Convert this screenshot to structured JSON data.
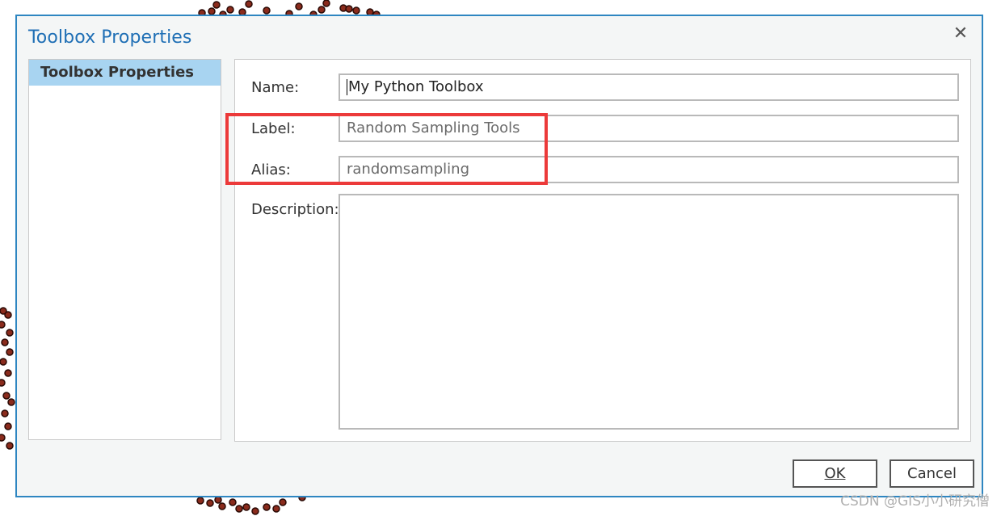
{
  "dialog": {
    "title": "Toolbox Properties",
    "close_icon": "close-icon",
    "nav": {
      "items": [
        {
          "label": "Toolbox Properties",
          "selected": true
        }
      ]
    },
    "form": {
      "name": {
        "label": "Name:",
        "value": "My Python Toolbox"
      },
      "label": {
        "label": "Label:",
        "value": "Random Sampling Tools"
      },
      "alias": {
        "label": "Alias:",
        "value": "randomsampling"
      },
      "description": {
        "label": "Description:",
        "value": ""
      }
    },
    "buttons": {
      "ok": "OK",
      "cancel": "Cancel"
    }
  },
  "watermark": "CSDN @GIS小小研究僧",
  "colors": {
    "title": "#1f6fb5",
    "border": "#2e86c1",
    "nav_selected": "#a8d4f1",
    "highlight": "#ec3a3a",
    "backdrop_dots": "#6b1d12"
  }
}
